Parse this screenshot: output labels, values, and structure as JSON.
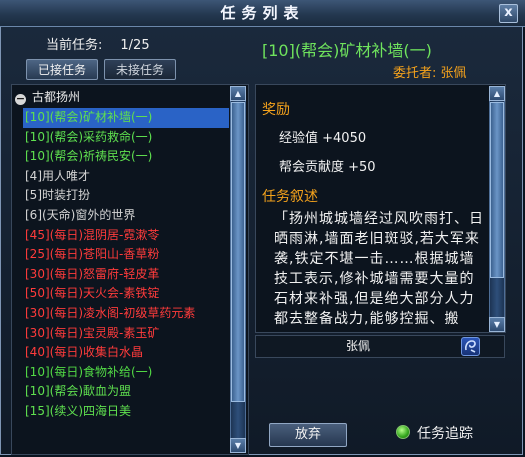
{
  "window": {
    "title": "任务列表",
    "close_glyph": "x"
  },
  "current_tasks": {
    "label": "当前任务:",
    "count": "1/25"
  },
  "tabs": {
    "accepted": "已接任务",
    "unaccepted": "未接任务"
  },
  "list": {
    "group_label": "古都扬州",
    "tasks": [
      {
        "label": "[10](帮会)矿材补墙(一)",
        "color": "guild",
        "selected": true
      },
      {
        "label": "[10](帮会)采药救命(一)",
        "color": "guild",
        "selected": false
      },
      {
        "label": "[10](帮会)祈祷民安(一)",
        "color": "guild",
        "selected": false
      },
      {
        "label": "[4]用人唯才",
        "color": "normal",
        "selected": false
      },
      {
        "label": "[5]时装打扮",
        "color": "normal",
        "selected": false
      },
      {
        "label": "[6](天命)窗外的世界",
        "color": "normal",
        "selected": false
      },
      {
        "label": "[45](每日)混阴居-霓漱苓",
        "color": "daily-red",
        "selected": false
      },
      {
        "label": "[25](每日)苍阳山-香草粉",
        "color": "daily-red",
        "selected": false
      },
      {
        "label": "[30](每日)怒雷府-轻皮革",
        "color": "daily-red",
        "selected": false
      },
      {
        "label": "[50](每日)天火会-素铁锭",
        "color": "daily-red",
        "selected": false
      },
      {
        "label": "[30](每日)凌水阁-初级草药元素",
        "color": "daily-red",
        "selected": false
      },
      {
        "label": "[30](每日)宝灵殿-素玉矿",
        "color": "daily-red",
        "selected": false
      },
      {
        "label": "[40](每日)收集白水晶",
        "color": "daily-red",
        "selected": false
      },
      {
        "label": "[10](每日)食物补给(一)",
        "color": "daily-green",
        "selected": false
      },
      {
        "label": "[10](帮会)歃血为盟",
        "color": "guild",
        "selected": false
      },
      {
        "label": "[15](续义)四海日美",
        "color": "guild",
        "selected": false
      }
    ]
  },
  "detail": {
    "title": "[10](帮会)矿材补墙(一)",
    "client": "委托者: 张佩",
    "reward_header": "奖励",
    "exp": "经验值 +4050",
    "contribution": "帮会贡献度 +50",
    "desc_header": "任务叙述",
    "description": "「扬州城城墙经过风吹雨打、日晒雨淋,墙面老旧斑驳,若大军来袭,铁定不堪一击……根据城墙技工表示,修补城墙需要大量的石材来补强,但是绝大部分人力都去整备战力,能够控掘、搬"
  },
  "npc": {
    "name": "张佩",
    "icon": "npc-locate-icon"
  },
  "buttons": {
    "abandon": "放弃",
    "track": "任务追踪"
  },
  "colors": {
    "guild": "#5fe04f",
    "normal": "#d4d4d4",
    "daily_red": "#ff3b3b",
    "daily_green": "#52da45",
    "header_orange": "#f4a21c",
    "selected_bg": "#2a63c6"
  }
}
